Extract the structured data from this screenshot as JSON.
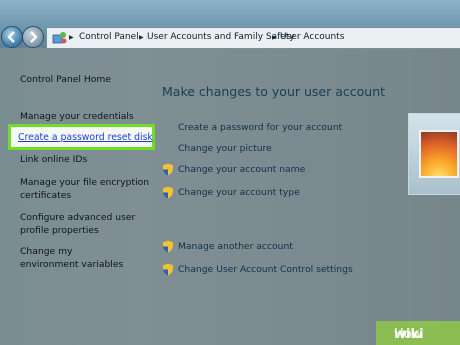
{
  "address_bar": {
    "breadcrumbs": [
      "Control Panel",
      "User Accounts and Family Safety",
      "User Accounts"
    ]
  },
  "sidebar": {
    "home": "Control Panel Home",
    "items": [
      "Manage your credentials",
      "Create a password reset disk",
      "Link online IDs",
      "Manage your file encryption certificates",
      "Configure advanced user profile properties",
      "Change my environment variables"
    ]
  },
  "main": {
    "heading": "Make changes to your user account",
    "links": [
      "Create a password for your account",
      "Change your picture",
      "Change your account name",
      "Change your account type"
    ],
    "other_links": [
      "Manage another account",
      "Change User Account Control settings"
    ]
  },
  "watermark": {
    "bold": "wiki",
    "thin": "How"
  },
  "colors": {
    "highlight": "#6ee021",
    "link": "#1b3fcb",
    "shield_blue": "#2f5fb3",
    "shield_yellow": "#f1c232"
  }
}
